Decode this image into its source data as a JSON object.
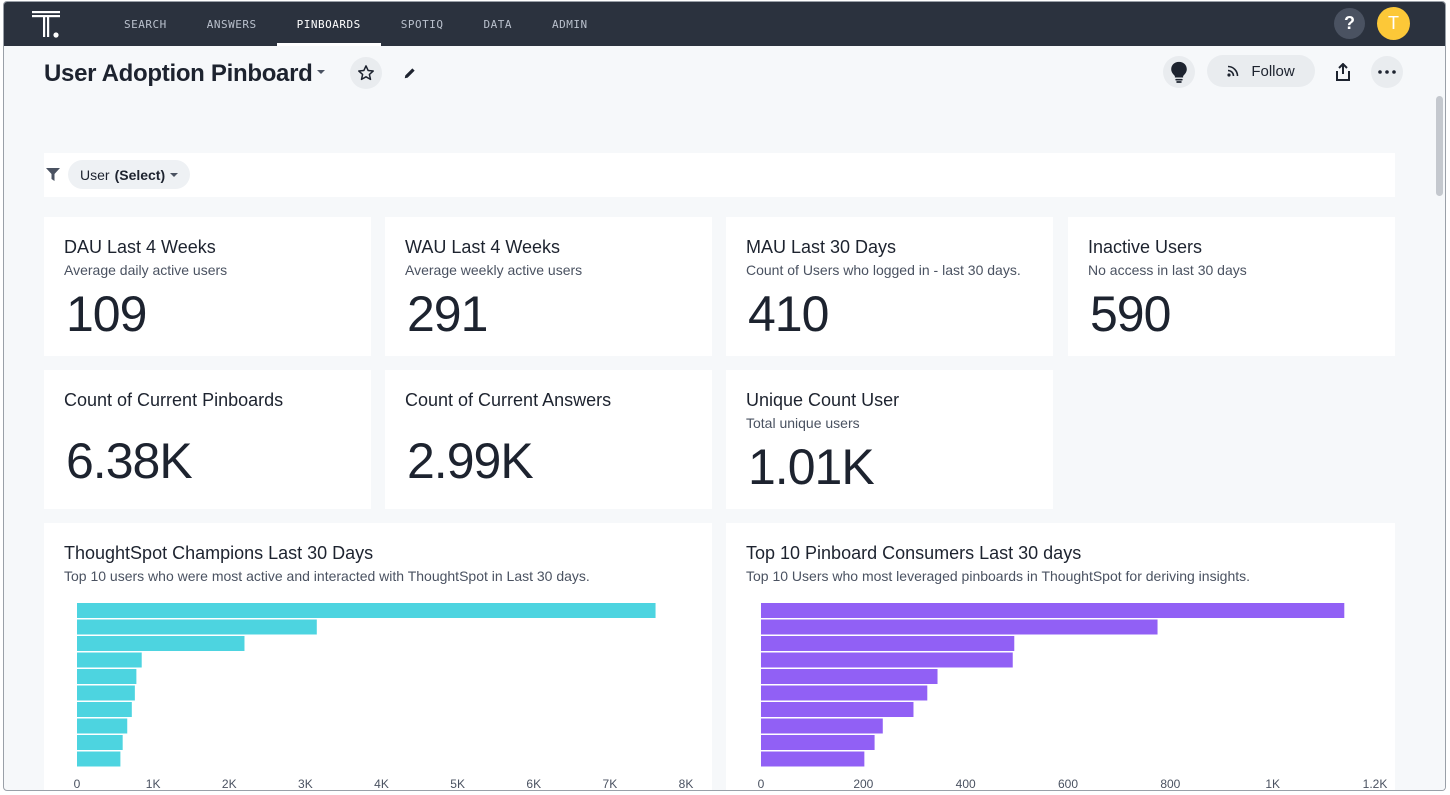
{
  "nav": {
    "tabs": [
      "SEARCH",
      "ANSWERS",
      "PINBOARDS",
      "SPOTIQ",
      "DATA",
      "ADMIN"
    ],
    "active": "PINBOARDS",
    "help_label": "?",
    "avatar_initial": "T"
  },
  "header": {
    "title": "User Adoption Pinboard",
    "follow_label": "Follow"
  },
  "filter": {
    "field": "User",
    "value": "(Select)"
  },
  "kpis": [
    {
      "title": "DAU Last 4 Weeks",
      "subtitle": "Average daily active users",
      "value": "109"
    },
    {
      "title": "WAU Last 4 Weeks",
      "subtitle": "Average weekly active users",
      "value": "291"
    },
    {
      "title": "MAU Last 30 Days",
      "subtitle": "Count of Users who logged in - last 30 days.",
      "value": "410"
    },
    {
      "title": "Inactive Users",
      "subtitle": "No access in last 30 days",
      "value": "590"
    },
    {
      "title": "Count of Current Pinboards",
      "subtitle": "",
      "value": "6.38K"
    },
    {
      "title": "Count of Current Answers",
      "subtitle": "",
      "value": "2.99K"
    },
    {
      "title": "Unique Count User",
      "subtitle": "Total unique users",
      "value": "1.01K"
    }
  ],
  "chart_data": [
    {
      "type": "bar",
      "orientation": "horizontal",
      "title": "ThoughtSpot Champions Last 30 Days",
      "subtitle": "Top 10 users who were most active and interacted with ThoughtSpot in Last 30 days.",
      "color": "#4dd4e0",
      "values": [
        7600,
        3150,
        2200,
        850,
        780,
        760,
        720,
        660,
        600,
        570
      ],
      "xlim": [
        0,
        8000
      ],
      "xticks": [
        0,
        1000,
        2000,
        3000,
        4000,
        5000,
        6000,
        7000,
        8000
      ],
      "xtick_labels": [
        "0",
        "1K",
        "2K",
        "3K",
        "4K",
        "5K",
        "6K",
        "7K",
        "8K"
      ]
    },
    {
      "type": "bar",
      "orientation": "horizontal",
      "title": "Top 10 Pinboard Consumers Last 30 days",
      "subtitle": "Top 10 Users who most leveraged pinboards in ThoughtSpot for deriving insights.",
      "color": "#9160f5",
      "values": [
        1140,
        775,
        495,
        492,
        345,
        325,
        298,
        238,
        222,
        202
      ],
      "xlim": [
        0,
        1200
      ],
      "xticks": [
        0,
        200,
        400,
        600,
        800,
        1000,
        1200
      ],
      "xtick_labels": [
        "0",
        "200",
        "400",
        "600",
        "800",
        "1K",
        "1.2K"
      ]
    }
  ]
}
